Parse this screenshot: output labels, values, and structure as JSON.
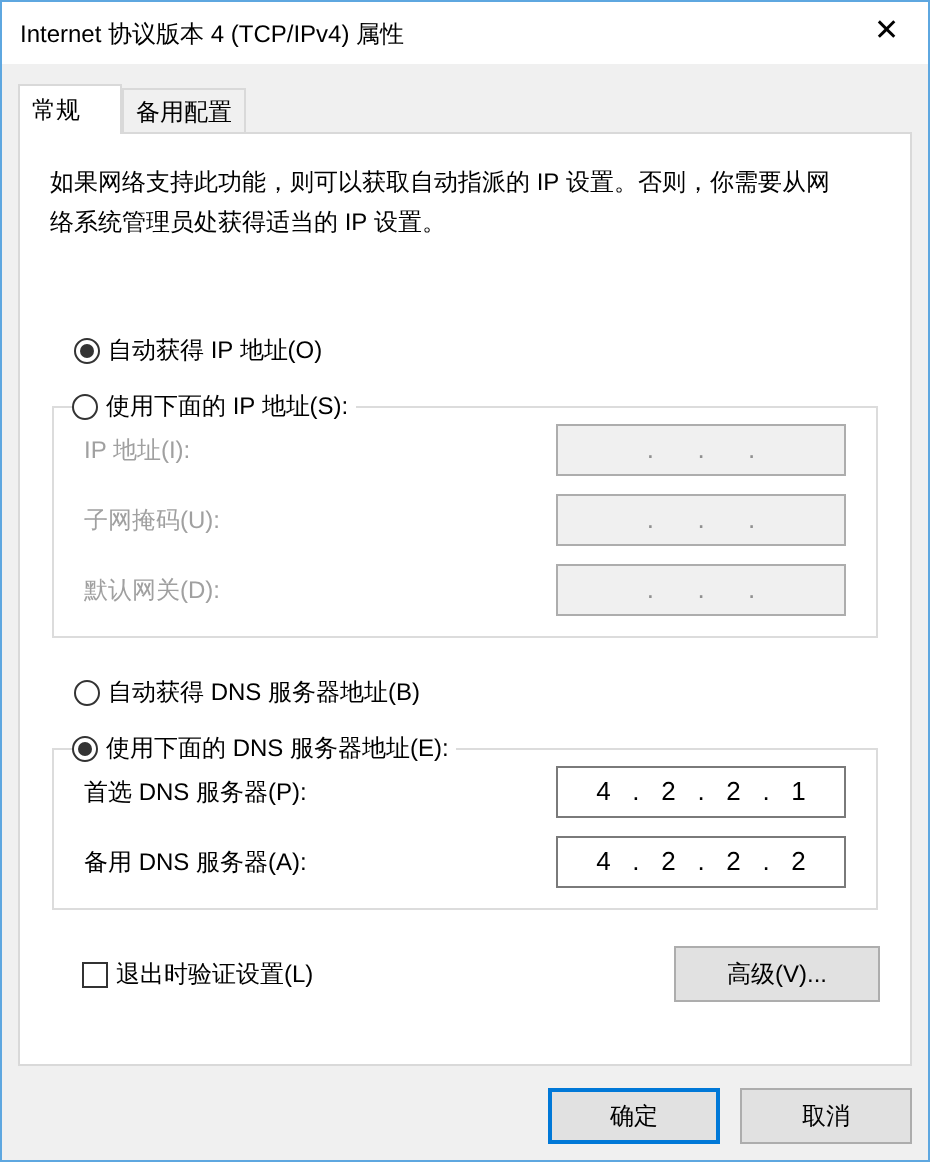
{
  "window": {
    "title": "Internet 协议版本 4 (TCP/IPv4) 属性",
    "close": "✕"
  },
  "tabs": [
    {
      "label": "常规",
      "selected": true
    },
    {
      "label": "备用配置",
      "selected": false
    }
  ],
  "description": "如果网络支持此功能，则可以获取自动指派的 IP 设置。否则，你需要从网络系统管理员处获得适当的 IP 设置。",
  "ip": {
    "auto_option": {
      "label": "自动获得 IP 地址(O)",
      "selected": true
    },
    "manual_option": {
      "label": "使用下面的 IP 地址(S):",
      "selected": false
    },
    "fields": [
      {
        "label": "IP 地址(I):",
        "value": ".      .      ."
      },
      {
        "label": "子网掩码(U):",
        "value": ".      .      ."
      },
      {
        "label": "默认网关(D):",
        "value": ".      .      ."
      }
    ]
  },
  "dns": {
    "auto_option": {
      "label": "自动获得 DNS 服务器地址(B)",
      "selected": false
    },
    "manual_option": {
      "label": "使用下面的 DNS 服务器地址(E):",
      "selected": true
    },
    "fields": [
      {
        "label": "首选 DNS 服务器(P):",
        "value": "4   .   2   .   2   .   1"
      },
      {
        "label": "备用 DNS 服务器(A):",
        "value": "4   .   2   .   2   .   2"
      }
    ]
  },
  "validate_checkbox": {
    "label": "退出时验证设置(L)",
    "checked": false
  },
  "advanced_button": {
    "label": "高级(V)..."
  },
  "buttons": [
    {
      "label": "确定",
      "default": true
    },
    {
      "label": "取消",
      "default": false
    }
  ]
}
